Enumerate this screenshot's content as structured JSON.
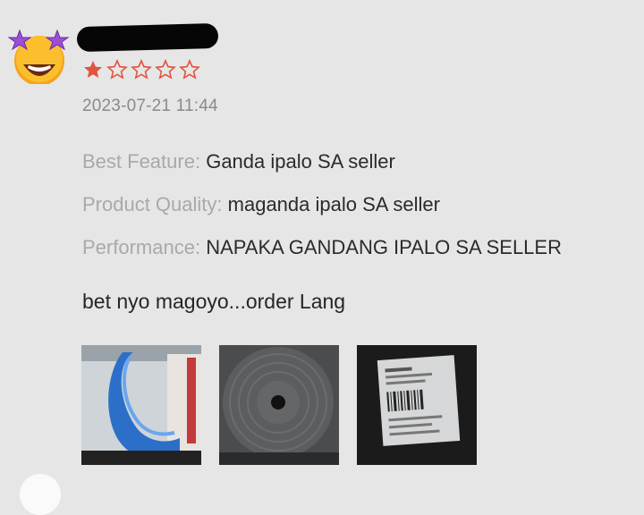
{
  "review": {
    "rating": 1,
    "rating_max": 5,
    "date": "2023-07-21 11:44",
    "attributes": [
      {
        "label": "Best Feature:",
        "value": "Ganda ipalo SA seller"
      },
      {
        "label": "Product Quality:",
        "value": "maganda ipalo SA seller"
      },
      {
        "label": "Performance:",
        "value": "NAPAKA GANDANG IPALO SA SELLER"
      }
    ],
    "comment": "bet nyo magoyo...order Lang",
    "photos": [
      "photo-blue-package",
      "photo-black-disc",
      "photo-shipping-label"
    ]
  },
  "icons": {
    "avatar": "star-struck-emoji-icon",
    "star_filled": "star-filled-icon",
    "star_empty": "star-outline-icon"
  },
  "colors": {
    "star": "#e2533f",
    "label": "#a9a9a9",
    "value": "#2b2b2b",
    "background": "#e6e6e6"
  }
}
